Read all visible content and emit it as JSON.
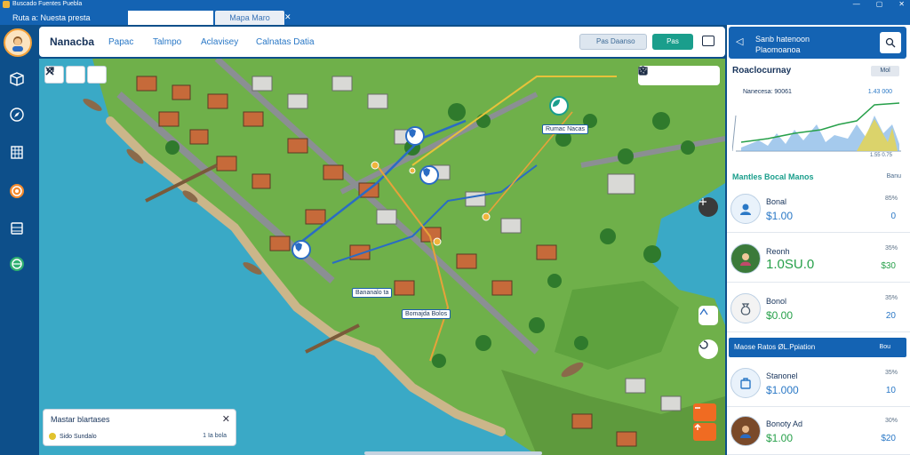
{
  "window": {
    "title": "Buscado Fuentes Puebla",
    "controls": [
      "—",
      "▢",
      "✕"
    ]
  },
  "tabs": [
    {
      "label": "Ruta  a:  Nuesta presta"
    },
    {
      "label": ""
    },
    {
      "label": "Mapa Maro"
    },
    {
      "label": "✕"
    }
  ],
  "rail": {
    "items": [
      "avatar",
      "cube-icon",
      "compass-icon",
      "building-icon",
      "target-icon",
      "layers-icon",
      "globe-icon"
    ]
  },
  "header": {
    "brand": "Nanacba",
    "nav": [
      "Papac",
      "Talmpo",
      "Aclavisey",
      "Calnatas Datia"
    ],
    "filter_label": "Pas Daanso",
    "go_label": "Pas",
    "window_icon": "window-icon"
  },
  "map": {
    "labels": [
      "Rumac Nacas",
      "Bananalo ta",
      "Bomajda Bolos"
    ],
    "card": {
      "title": "Mastar blartases",
      "status": "Sido Sundalo",
      "right": "1 Ia bola"
    }
  },
  "panel": {
    "header": "Sanb hatenoon\nPlaomoanoa",
    "chart_title": "Roaclocurnay",
    "chart_btn": "Mol",
    "chart_value_left": "Nanecesa: 90061",
    "chart_value_right": "1.43 000",
    "chart_axis": "1.55  0.75",
    "section_title": "Mantles Bocal Manos",
    "section_right": "Banu",
    "band": "Maose Ratos ØL.Ppiation",
    "band_right": "Bou",
    "items": [
      {
        "name": "Bonal",
        "amount": "$1.00",
        "pct": "85%",
        "right": "0"
      },
      {
        "name": "Reonh",
        "amount": "1.0SU.0",
        "pct": "35%",
        "right": "$30"
      },
      {
        "name": "Bonol",
        "amount": "$0.00",
        "pct": "35%",
        "right": "20"
      },
      {
        "name": "Stanonel",
        "amount": "$1.000",
        "pct": "35%",
        "right": "10"
      },
      {
        "name": "Bonoty Ad",
        "amount": "$1.00",
        "pct": "30%",
        "right": "$20"
      }
    ]
  },
  "colors": {
    "brand_blue": "#1463b3",
    "teal": "#1a9e8c",
    "green": "#27a04a",
    "orange": "#f06b22"
  }
}
